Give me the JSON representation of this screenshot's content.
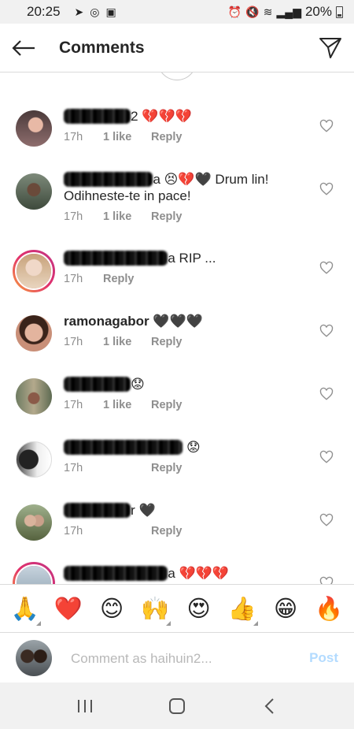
{
  "status_bar": {
    "time": "20:25",
    "battery": "20%"
  },
  "header": {
    "title": "Comments"
  },
  "comments": [
    {
      "username": "blurred",
      "text": "2 💔💔💔",
      "time": "17h",
      "likes": "1 like",
      "reply": "Reply"
    },
    {
      "username": "blurred",
      "text": "a 😣💔🖤 Drum lin! Odihneste-te in pace!",
      "time": "17h",
      "likes": "1 like",
      "reply": "Reply"
    },
    {
      "username": "blurred",
      "text": "a RIP ...",
      "time": "17h",
      "likes": "",
      "reply": "Reply"
    },
    {
      "username": "ramonagabor",
      "text": "🖤🖤🖤",
      "time": "17h",
      "likes": "1 like",
      "reply": "Reply"
    },
    {
      "username": "blurred",
      "text": "😟",
      "time": "17h",
      "likes": "1 like",
      "reply": "Reply"
    },
    {
      "username": "blurred",
      "text": "😟",
      "time": "17h",
      "likes": "",
      "reply": "Reply"
    },
    {
      "username": "blurred",
      "text": "r 🖤",
      "time": "17h",
      "likes": "",
      "reply": "Reply"
    },
    {
      "username": "blurred",
      "text": "a 💔💔💔",
      "time": "",
      "likes": "",
      "reply": ""
    }
  ],
  "emoji_bar": [
    "🙏",
    "❤️",
    "😊",
    "🙌",
    "😍",
    "👍",
    "😁",
    "🔥"
  ],
  "input": {
    "placeholder": "Comment as haihuin2...",
    "post_label": "Post"
  }
}
